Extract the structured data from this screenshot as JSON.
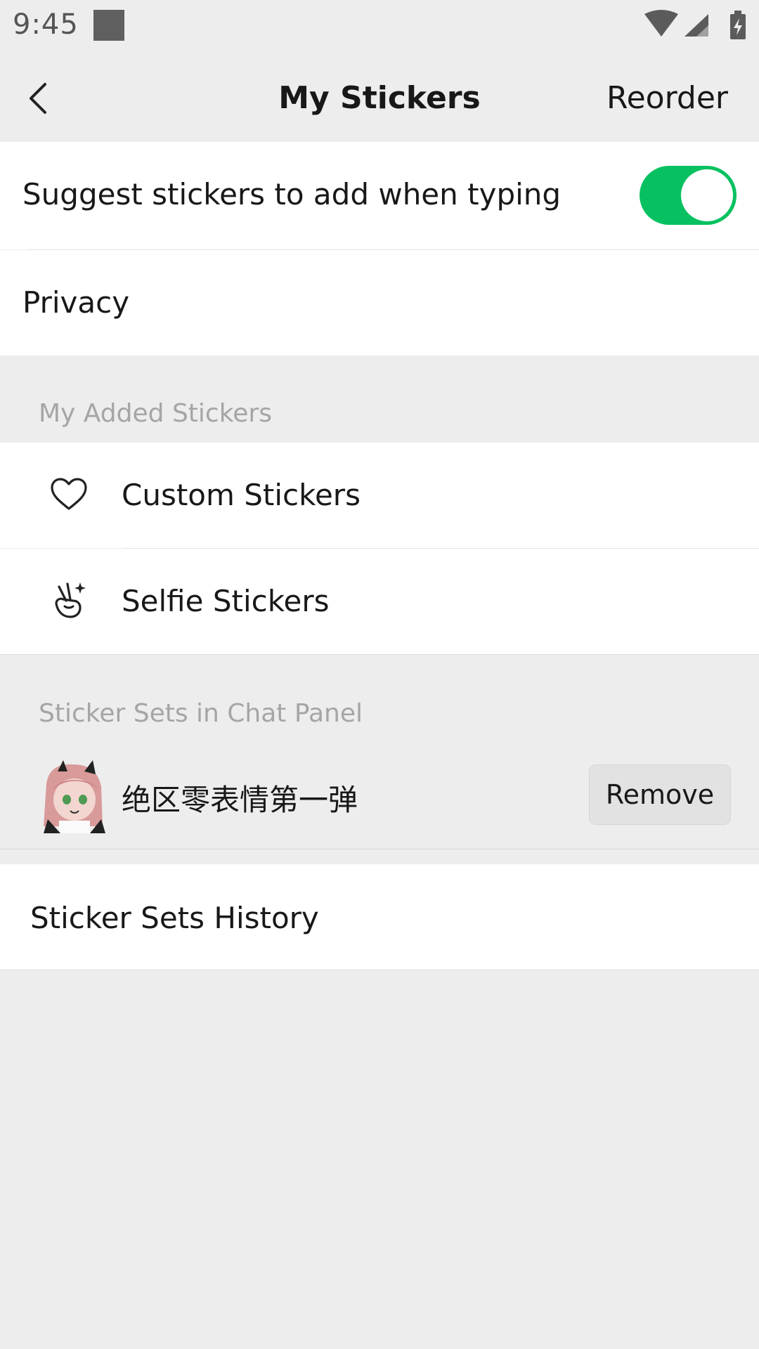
{
  "status_bar": {
    "time": "9:45"
  },
  "nav": {
    "title": "My Stickers",
    "reorder": "Reorder"
  },
  "settings": {
    "suggest_label": "Suggest stickers to add when typing",
    "suggest_enabled": true,
    "privacy_label": "Privacy"
  },
  "my_added": {
    "header": "My Added Stickers",
    "items": [
      {
        "label": "Custom Stickers",
        "icon": "heart-icon"
      },
      {
        "label": "Selfie Stickers",
        "icon": "selfie-hand-icon"
      }
    ]
  },
  "chat_panel": {
    "header": "Sticker Sets in Chat Panel",
    "sets": [
      {
        "name": "绝区零表情第一弹",
        "action": "Remove"
      }
    ]
  },
  "history": {
    "label": "Sticker Sets History"
  },
  "colors": {
    "accent": "#07c160",
    "background": "#ededed"
  }
}
